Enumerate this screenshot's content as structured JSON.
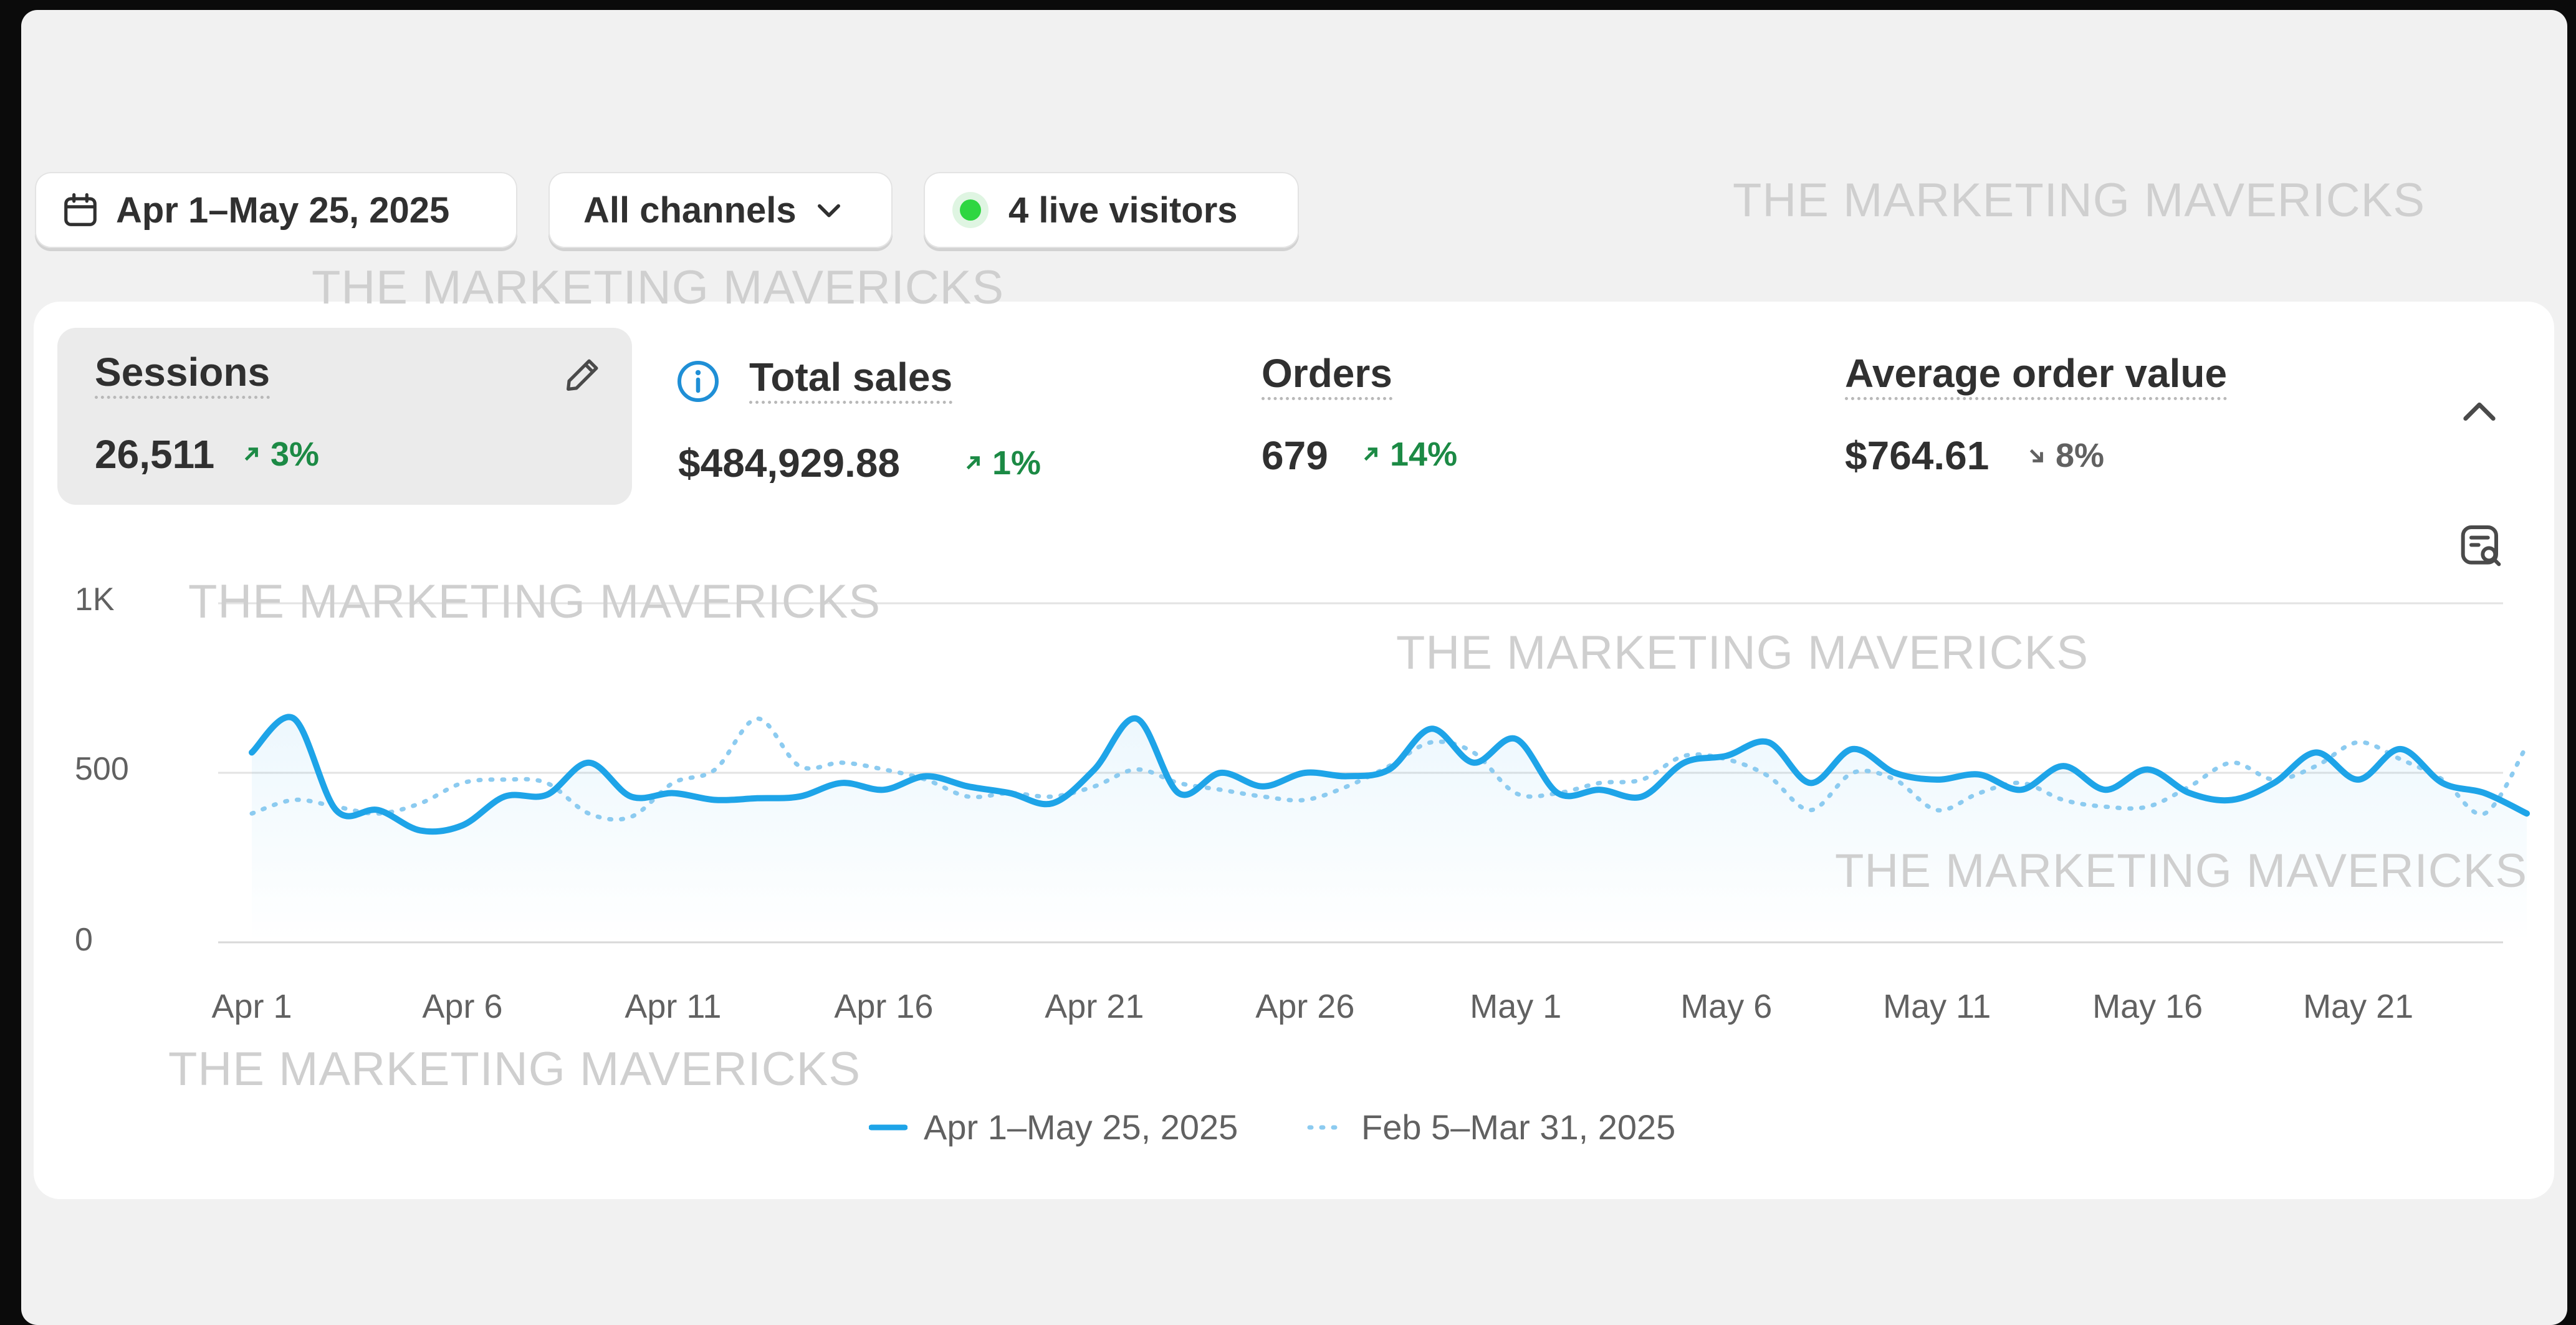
{
  "filters": {
    "date_range": "Apr 1–May 25, 2025",
    "channel": "All channels",
    "live_visitors": "4 live visitors"
  },
  "metrics": [
    {
      "label": "Sessions",
      "value": "26,511",
      "delta": "3%",
      "direction": "up"
    },
    {
      "label": "Total sales",
      "value": "$484,929.88",
      "delta": "1%",
      "direction": "up"
    },
    {
      "label": "Orders",
      "value": "679",
      "delta": "14%",
      "direction": "up"
    },
    {
      "label": "Average order value",
      "value": "$764.61",
      "delta": "8%",
      "direction": "down"
    }
  ],
  "watermark": "THE MARKETING MAVERICKS",
  "colors": {
    "accent": "#1ea4e8",
    "up": "#1c8a45",
    "down": "#616161",
    "live": "#2ed641"
  },
  "icons": [
    "calendar-icon",
    "chevron-down-icon",
    "live-dot-icon",
    "pencil-icon",
    "info-icon",
    "chevron-up-icon",
    "report-search-icon"
  ],
  "chart_data": {
    "type": "line",
    "title": "",
    "xlabel": "",
    "ylabel": "",
    "ylim": [
      0,
      1000
    ],
    "y_ticks": [
      "1K",
      "500",
      "0"
    ],
    "x_tick_labels": [
      "Apr 1",
      "Apr 6",
      "Apr 11",
      "Apr 16",
      "Apr 21",
      "Apr 26",
      "May 1",
      "May 6",
      "May 11",
      "May 16",
      "May 21"
    ],
    "x": [
      "Apr 1",
      "Apr 2",
      "Apr 3",
      "Apr 4",
      "Apr 5",
      "Apr 6",
      "Apr 7",
      "Apr 8",
      "Apr 9",
      "Apr 10",
      "Apr 11",
      "Apr 12",
      "Apr 13",
      "Apr 14",
      "Apr 15",
      "Apr 16",
      "Apr 17",
      "Apr 18",
      "Apr 19",
      "Apr 20",
      "Apr 21",
      "Apr 22",
      "Apr 23",
      "Apr 24",
      "Apr 25",
      "Apr 26",
      "Apr 27",
      "Apr 28",
      "Apr 29",
      "Apr 30",
      "May 1",
      "May 2",
      "May 3",
      "May 4",
      "May 5",
      "May 6",
      "May 7",
      "May 8",
      "May 9",
      "May 10",
      "May 11",
      "May 12",
      "May 13",
      "May 14",
      "May 15",
      "May 16",
      "May 17",
      "May 18",
      "May 19",
      "May 20",
      "May 21",
      "May 22",
      "May 23",
      "May 24",
      "May 25"
    ],
    "series": [
      {
        "name": "Apr 1–May 25, 2025",
        "style": "solid",
        "values": [
          560,
          660,
          390,
          390,
          330,
          345,
          430,
          435,
          530,
          430,
          440,
          420,
          425,
          430,
          470,
          450,
          490,
          460,
          440,
          410,
          510,
          660,
          440,
          500,
          460,
          500,
          490,
          510,
          630,
          530,
          600,
          440,
          450,
          430,
          530,
          550,
          590,
          470,
          570,
          500,
          480,
          495,
          450,
          520,
          450,
          510,
          440,
          420,
          470,
          560,
          480,
          570,
          470,
          440,
          380
        ]
      },
      {
        "name": "Feb 5–Mar 31, 2025",
        "style": "dotted",
        "values": [
          380,
          420,
          400,
          380,
          410,
          470,
          480,
          470,
          380,
          370,
          470,
          510,
          660,
          520,
          530,
          510,
          480,
          430,
          440,
          430,
          460,
          510,
          470,
          450,
          430,
          420,
          460,
          520,
          590,
          560,
          440,
          440,
          470,
          480,
          550,
          540,
          490,
          390,
          500,
          480,
          390,
          440,
          470,
          420,
          400,
          400,
          460,
          530,
          480,
          520,
          590,
          540,
          480,
          380,
          580
        ]
      }
    ]
  }
}
